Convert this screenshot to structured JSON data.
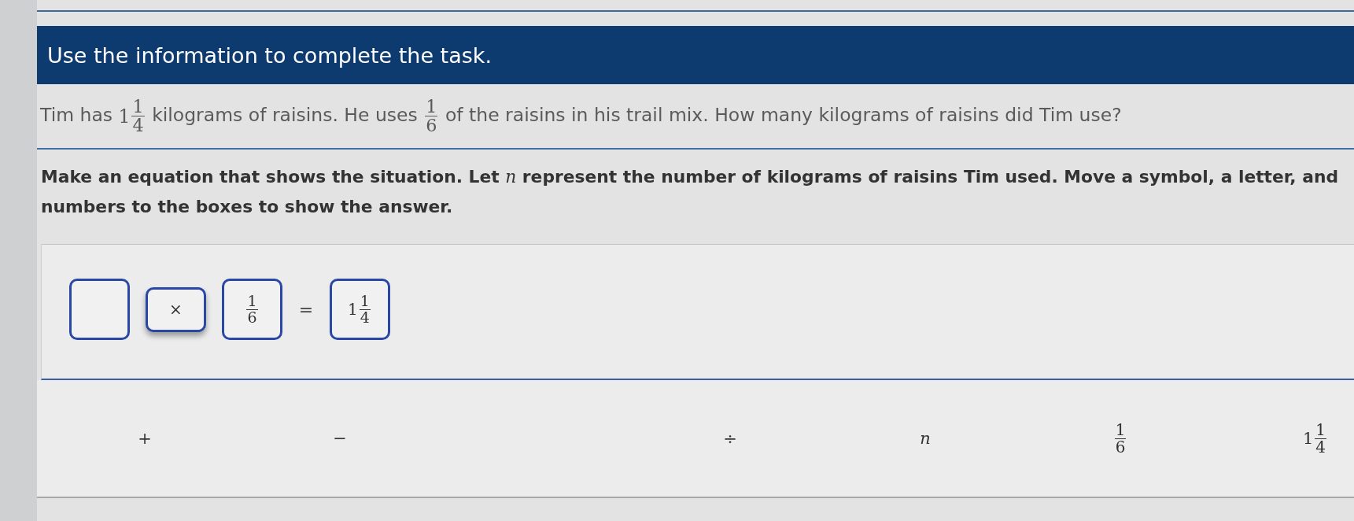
{
  "header": {
    "title": "Use the information to complete the task."
  },
  "question": {
    "segments": [
      {
        "kind": "text",
        "text": "Tim has "
      },
      {
        "kind": "mixed",
        "whole": "1",
        "numerator": "1",
        "denominator": "4"
      },
      {
        "kind": "text",
        "text": " kilograms of raisins. He uses "
      },
      {
        "kind": "fraction",
        "numerator": "1",
        "denominator": "6"
      },
      {
        "kind": "text",
        "text": " of the raisins in his trail mix. How many kilograms of raisins did Tim use?"
      }
    ]
  },
  "instruction": "Make an equation that shows the situation. Let *n* represent the number of kilograms of raisins Tim used. Move a symbol, a letter, and numbers to the boxes to show the answer.",
  "equation": [
    {
      "kind": "number_slot"
    },
    {
      "kind": "operator_slot",
      "tile": {
        "kind": "symbol",
        "text": "×"
      }
    },
    {
      "kind": "number_slot",
      "tile": {
        "kind": "fraction",
        "numerator": "1",
        "denominator": "6"
      }
    },
    {
      "kind": "sign",
      "text": "="
    },
    {
      "kind": "number_slot",
      "tile": {
        "kind": "mixed",
        "whole": "1",
        "numerator": "1",
        "denominator": "4"
      }
    }
  ],
  "tile_bank": [
    {
      "kind": "symbol",
      "text": "+"
    },
    {
      "kind": "symbol",
      "text": "−"
    },
    {
      "kind": "empty"
    },
    {
      "kind": "symbol",
      "text": "÷"
    },
    {
      "kind": "letter",
      "text": "n"
    },
    {
      "kind": "fraction",
      "numerator": "1",
      "denominator": "6"
    },
    {
      "kind": "mixed",
      "whole": "1",
      "numerator": "1",
      "denominator": "4"
    }
  ]
}
